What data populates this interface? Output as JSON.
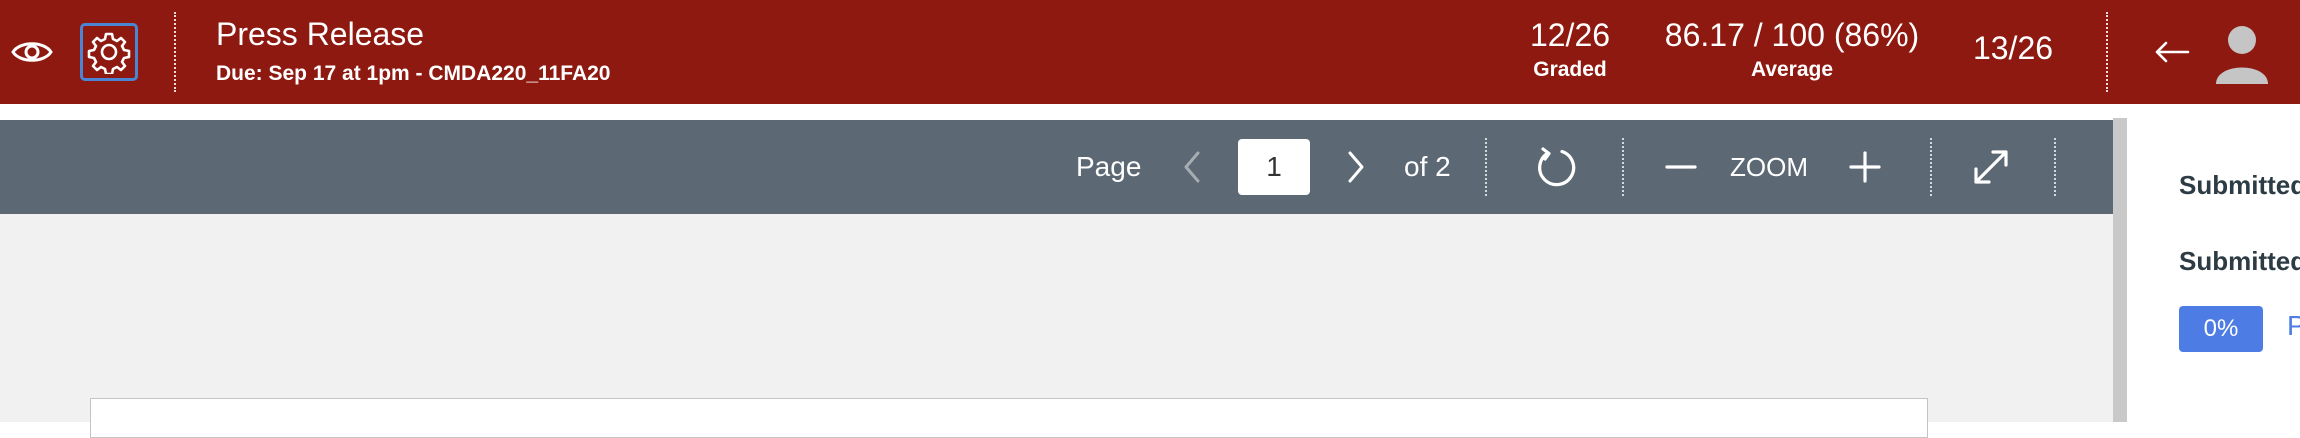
{
  "colors": {
    "header_bg": "#8e1911",
    "toolbar_bg": "#5c6873",
    "accent_blue": "#4d7de4",
    "doc_bg": "#f1f1f1"
  },
  "header": {
    "title": "Press Release",
    "subtitle": "Due: Sep 17 at 1pm - CMDA220_11FA20",
    "graded_value": "12/26",
    "graded_label": "Graded",
    "average_value": "86.17 / 100 (86%)",
    "average_label": "Average",
    "student_position": "13/26",
    "icons": [
      "eye-icon",
      "gear-icon",
      "back-arrow-icon",
      "avatar-icon"
    ]
  },
  "toolbar": {
    "page_label": "Page",
    "page_value": "1",
    "of_label": "of 2",
    "zoom_label": "ZOOM",
    "icons": [
      "prev-page-icon",
      "next-page-icon",
      "rotate-icon",
      "zoom-out-icon",
      "zoom-in-icon",
      "fullscreen-icon"
    ]
  },
  "right_panel": {
    "submitted_1": "Submitted",
    "submitted_2": "Submitted",
    "percent_badge": "0%",
    "link_fragment": "P"
  }
}
